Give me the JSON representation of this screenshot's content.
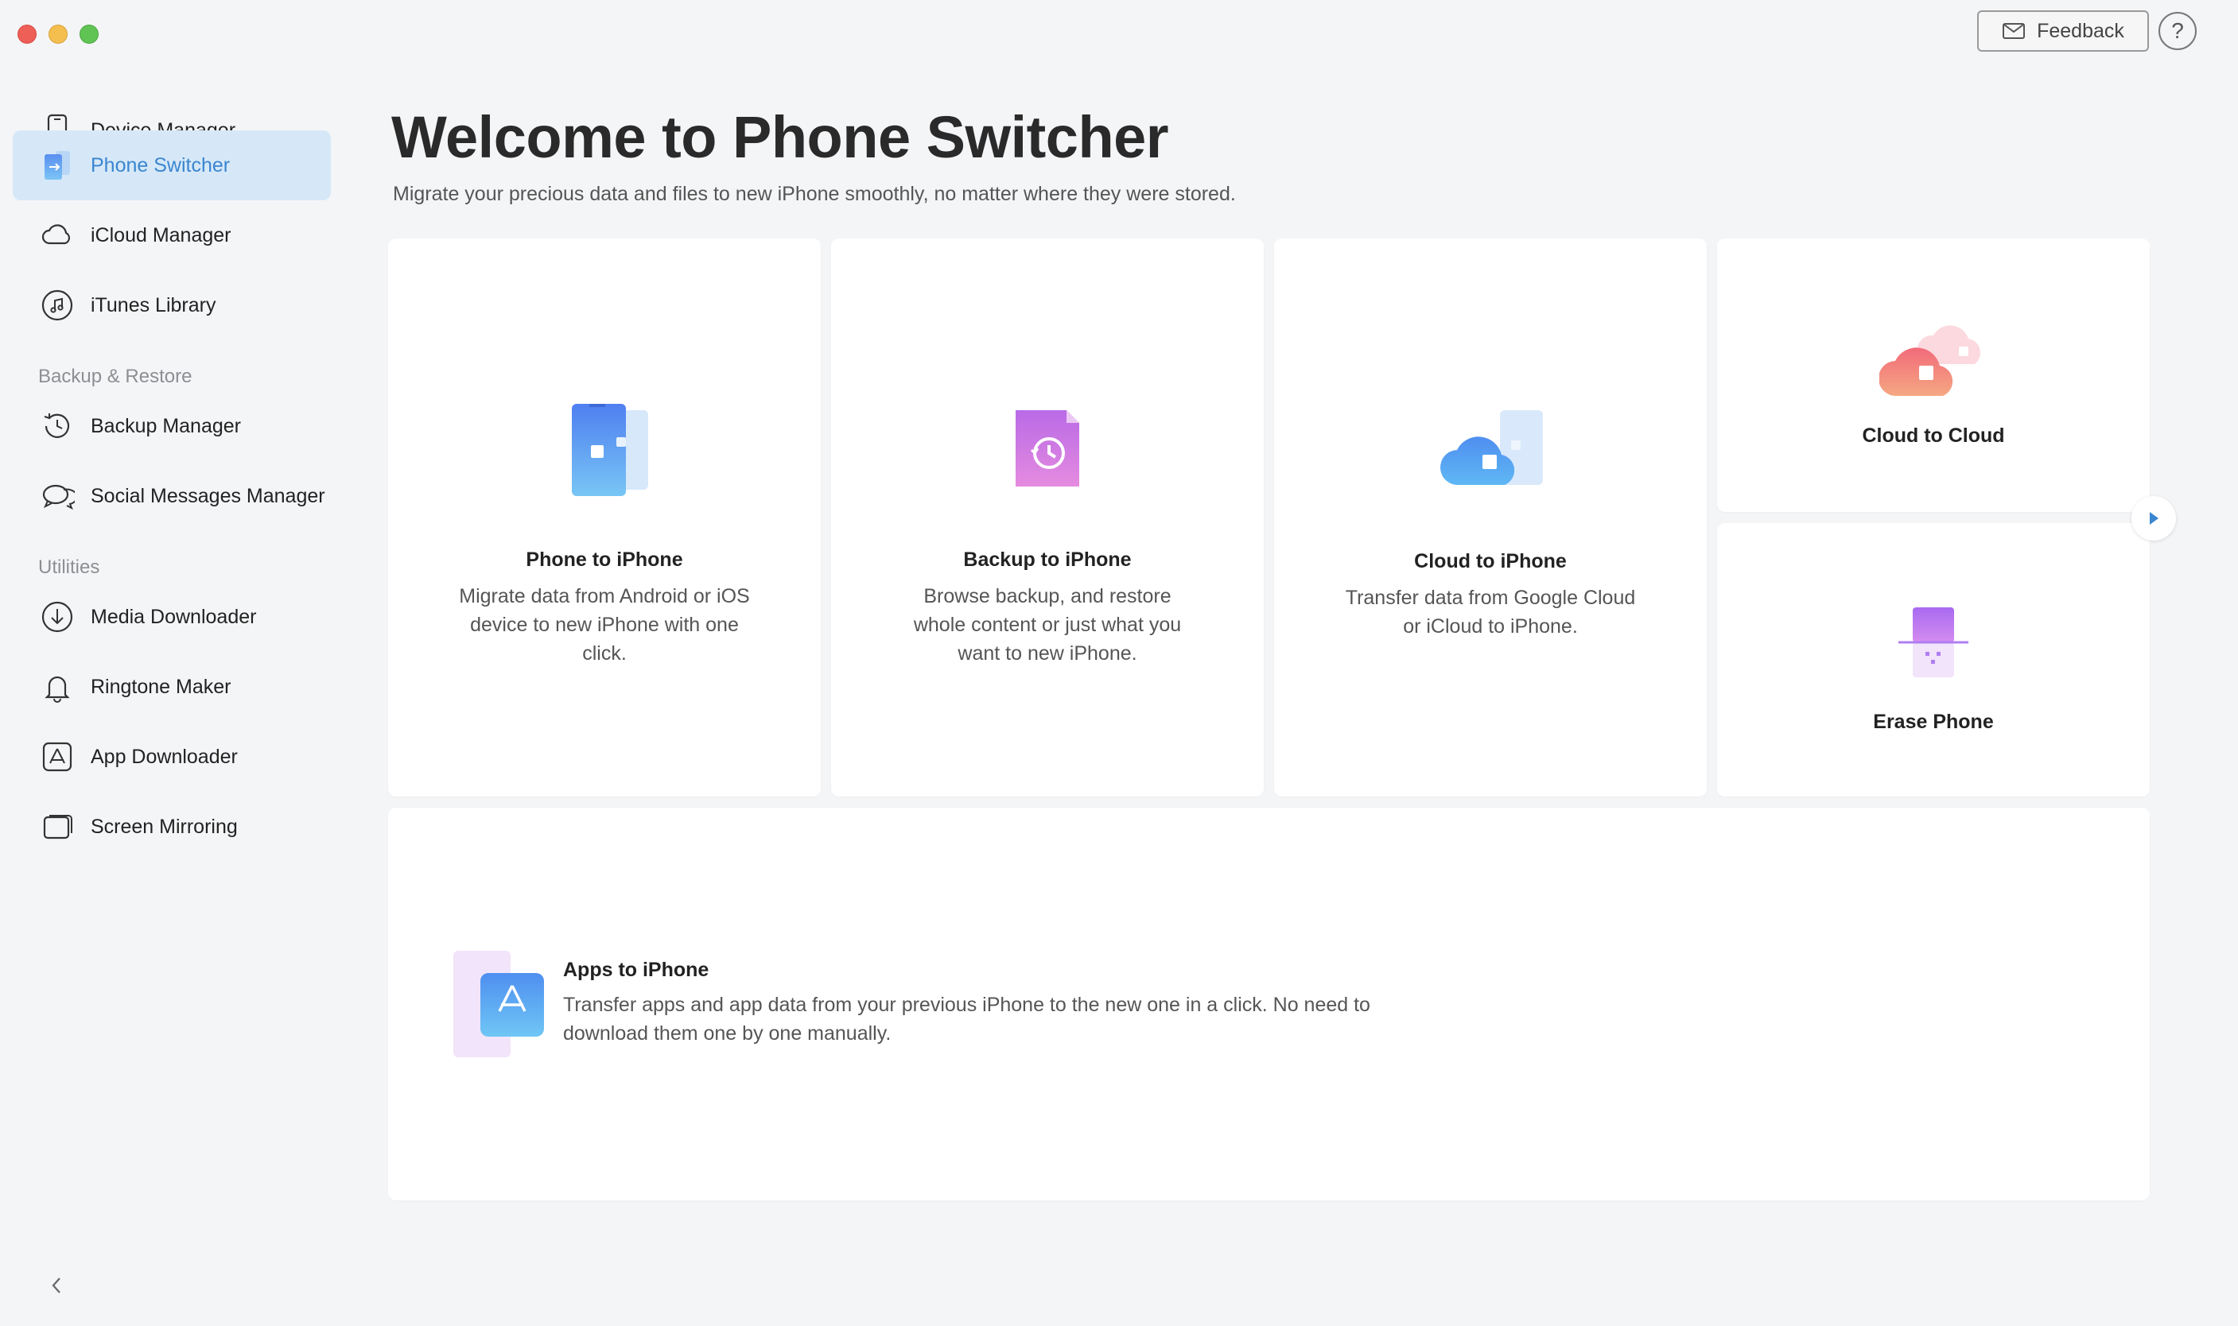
{
  "window": {
    "feedback_label": "Feedback",
    "help_label": "?"
  },
  "sidebar": {
    "items": [
      {
        "label": "Device Manager",
        "icon": "phone-outline-icon"
      },
      {
        "label": "Phone Switcher",
        "icon": "phone-switcher-icon",
        "active": true
      },
      {
        "label": "iCloud Manager",
        "icon": "cloud-icon"
      },
      {
        "label": "iTunes Library",
        "icon": "music-note-icon"
      }
    ],
    "section_backup": "Backup & Restore",
    "backup_items": [
      {
        "label": "Backup Manager",
        "icon": "history-icon"
      },
      {
        "label": "Social Messages Manager",
        "icon": "chat-bubbles-icon"
      }
    ],
    "section_utilities": "Utilities",
    "utility_items": [
      {
        "label": "Media Downloader",
        "icon": "download-icon"
      },
      {
        "label": "Ringtone Maker",
        "icon": "bell-icon"
      },
      {
        "label": "App Downloader",
        "icon": "app-store-icon"
      },
      {
        "label": "Screen Mirroring",
        "icon": "screen-mirroring-icon"
      }
    ]
  },
  "main": {
    "title": "Welcome to Phone Switcher",
    "subtitle": "Migrate your precious data and files to new iPhone smoothly, no matter where they were stored.",
    "cards": {
      "phone_to_iphone": {
        "title": "Phone to iPhone",
        "desc": "Migrate data from Android or iOS device to new iPhone with one click."
      },
      "backup_to_iphone": {
        "title": "Backup to iPhone",
        "desc": "Browse backup, and restore whole content or just what you want to new iPhone."
      },
      "cloud_to_iphone": {
        "title": "Cloud to iPhone",
        "desc": "Transfer data from Google Cloud or iCloud to iPhone."
      },
      "cloud_to_cloud": {
        "title": "Cloud to Cloud"
      },
      "erase_phone": {
        "title": "Erase Phone"
      },
      "apps_to_iphone": {
        "title": "Apps to iPhone",
        "desc": "Transfer apps and app data from your previous iPhone to the new one in a click. No need to download them one by one manually."
      }
    }
  },
  "colors": {
    "accent": "#3a86d0",
    "active_bg": "#d6e8f8",
    "background": "#f4f5f7"
  }
}
